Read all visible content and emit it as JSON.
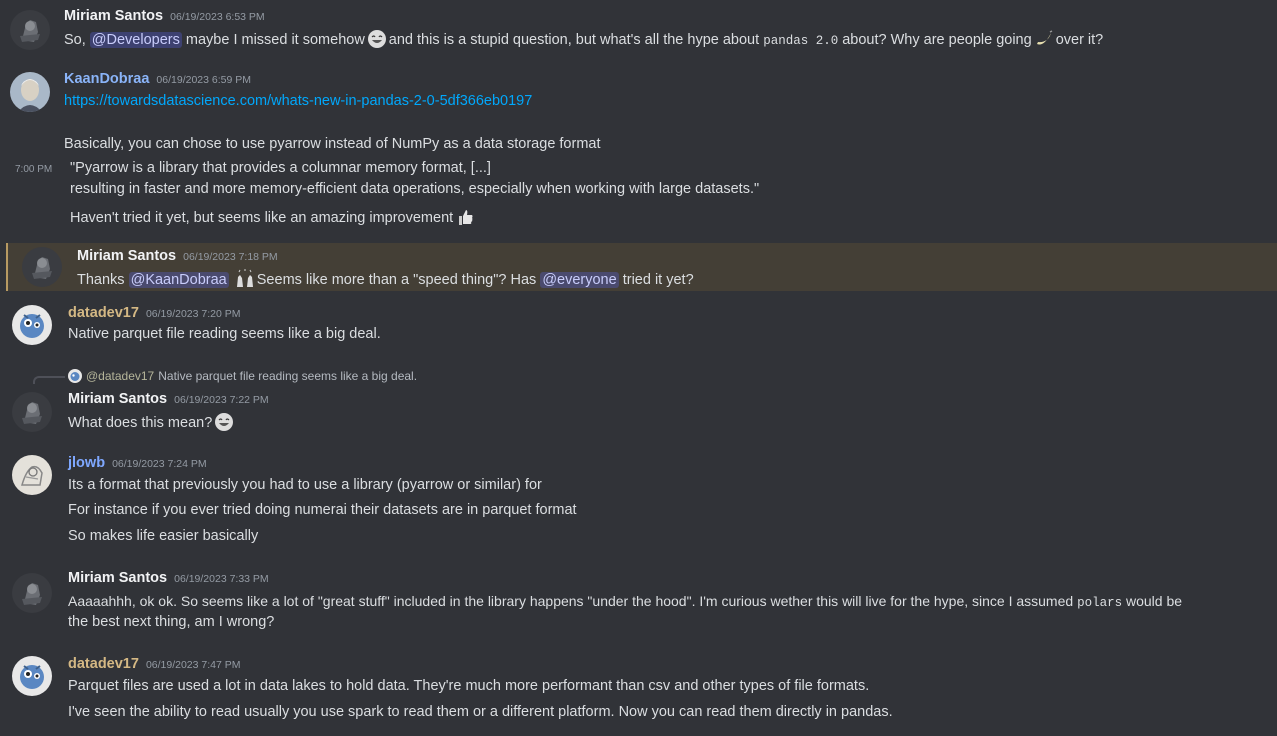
{
  "colors": {
    "background": "#313338",
    "highlight": "#443f36",
    "mention_bg": "#3c4270",
    "link": "#00a8fc",
    "name_default": "#f2f3f5",
    "name_kaan": "#8ab4f8",
    "name_datadev": "#d4b884",
    "name_jlowb": "#7fa8ff"
  },
  "messages": [
    {
      "author": "Miriam Santos",
      "timestamp": "06/19/2023 6:53 PM",
      "avatar_icon": "anime-character-avatar",
      "line1_pre": "So,",
      "line1_mention": "@Developers",
      "line1_mid": "maybe I missed it somehow",
      "line1_mid2": "and this is a stupid question, but what's all the hype about",
      "line1_code": "pandas 2.0",
      "line1_post": "about? Why are people going",
      "line1_end": "over it?"
    },
    {
      "author": "KaanDobraa",
      "timestamp": "06/19/2023 6:59 PM",
      "avatar_icon": "portrait-avatar",
      "link": "https://towardsdatascience.com/whats-new-in-pandas-2-0-5df366eb0197",
      "line2": "Basically, you can chose to use pyarrow instead of NumPy as a data storage format",
      "side_time": "7:00 PM",
      "quote1": "\"Pyarrow is a library that provides a columnar memory format, [...]",
      "quote2": "resulting in faster and more memory-efficient data operations, especially when working with large datasets.\"",
      "line3": "Haven't tried it yet, but seems like an amazing improvement"
    },
    {
      "author": "Miriam Santos",
      "timestamp": "06/19/2023 7:18 PM",
      "pre": "Thanks",
      "mention1": "@KaanDobraa",
      "mid": "Seems like more than a \"speed thing\"? Has",
      "mention2": "@everyone",
      "post": "tried it yet?"
    },
    {
      "author": "datadev17",
      "timestamp": "06/19/2023 7:20 PM",
      "avatar_icon": "robot-avatar",
      "text": "Native parquet file reading seems like a big deal."
    },
    {
      "reply_author": "@datadev17",
      "reply_text": "Native parquet file reading seems like a big deal.",
      "author": "Miriam Santos",
      "timestamp": "06/19/2023 7:22 PM",
      "text": "What does this mean?"
    },
    {
      "author": "jlowb",
      "timestamp": "06/19/2023 7:24 PM",
      "avatar_icon": "sketch-avatar",
      "line1": "Its a format that previously you had to use a library (pyarrow or similar) for",
      "line2": "For instance if you ever tried doing numerai their datasets are in parquet format",
      "line3": "So makes life easier basically"
    },
    {
      "author": "Miriam Santos",
      "timestamp": "06/19/2023 7:33 PM",
      "line1_pre": "Aaaaahhh, ok ok. So seems like a lot of \"great stuff\" included in the library happens \"under the hood\". I'm curious wether this will live for the hype, since I assumed",
      "line1_code": "polars",
      "line1_post": "would be",
      "line2": "the best next thing, am I wrong?"
    },
    {
      "author": "datadev17",
      "timestamp": "06/19/2023 7:47 PM",
      "line1": "Parquet files are used a lot in data lakes to hold data. They're much more performant than csv and other types of file formats.",
      "line2": "I've seen the ability to read usually you use spark to read them or a different platform. Now you can read them directly in pandas."
    }
  ]
}
